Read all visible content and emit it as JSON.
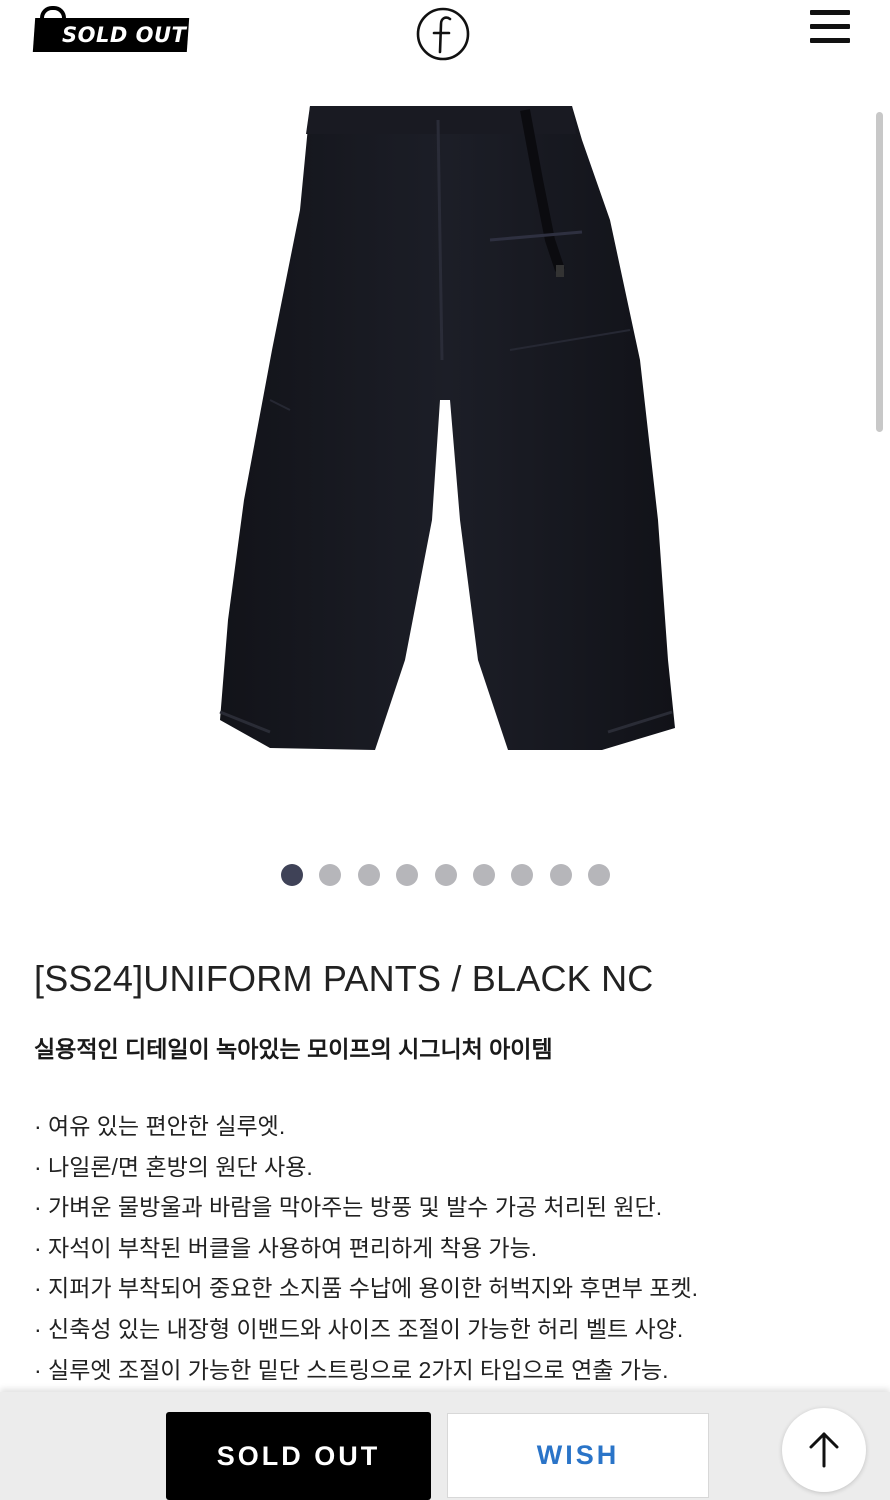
{
  "header": {
    "badge_text": "SOLD OUT",
    "logo_icon": "f-circle-logo",
    "menu_icon": "hamburger-menu-icon"
  },
  "gallery": {
    "image_alt": "Black uniform pants",
    "dots_count": 9,
    "active_index": 0
  },
  "product": {
    "title": "[SS24]UNIFORM PANTS / BLACK NC",
    "subtitle": "실용적인 디테일이 녹아있는 모이프의 시그니처 아이템",
    "features": [
      "· 여유 있는 편안한 실루엣.",
      "· 나일론/면 혼방의 원단 사용.",
      "· 가벼운 물방울과 바람을 막아주는 방풍 및 발수 가공 처리된 원단.",
      "· 자석이 부착된 버클을 사용하여 편리하게 착용 가능.",
      "· 지퍼가 부착되어 중요한 소지품 수납에 용이한 허벅지와 후면부 포켓.",
      "· 신축성 있는 내장형 이밴드와 사이즈 조절이 가능한 허리 벨트 사양.",
      "· 실루엣 조절이 가능한 밑단 스트링으로 2가지 타입으로 연출 가능."
    ]
  },
  "actions": {
    "soldout_label": "SOLD OUT",
    "wish_label": "WISH",
    "top_icon": "arrow-up-icon"
  },
  "colors": {
    "active_dot": "#3f4257",
    "inactive_dot": "#b6b6ba",
    "wish_text": "#2a74c8",
    "bottom_bar": "#ececec"
  }
}
